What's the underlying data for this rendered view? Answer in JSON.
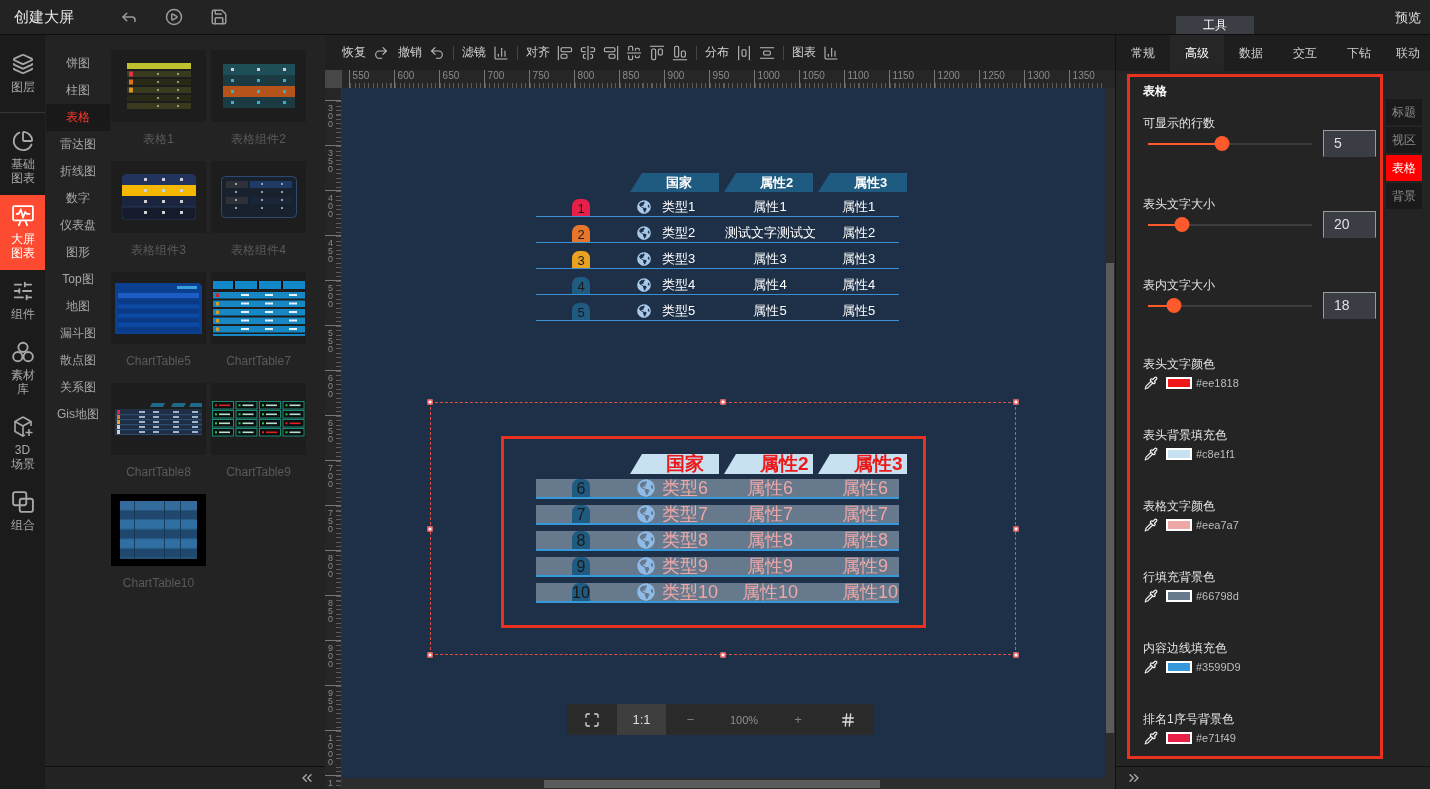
{
  "header": {
    "title": "创建大屏",
    "tool_tab": "工具",
    "preview": "预览"
  },
  "rail": [
    {
      "label": "图层",
      "selected": false
    },
    {
      "label": "基础图表",
      "selected": false
    },
    {
      "label": "大屏图表",
      "selected": true
    },
    {
      "label": "组件",
      "selected": false
    },
    {
      "label": "素材库",
      "selected": false
    },
    {
      "label": "3D场景",
      "selected": false
    },
    {
      "label": "组合",
      "selected": false
    }
  ],
  "categories": [
    {
      "label": "饼图",
      "selected": false
    },
    {
      "label": "柱图",
      "selected": false
    },
    {
      "label": "表格",
      "selected": true
    },
    {
      "label": "雷达图",
      "selected": false
    },
    {
      "label": "折线图",
      "selected": false
    },
    {
      "label": "数字",
      "selected": false
    },
    {
      "label": "仪表盘",
      "selected": false
    },
    {
      "label": "图形",
      "selected": false
    },
    {
      "label": "Top图",
      "selected": false
    },
    {
      "label": "地图",
      "selected": false
    },
    {
      "label": "漏斗图",
      "selected": false
    },
    {
      "label": "散点图",
      "selected": false
    },
    {
      "label": "关系图",
      "selected": false
    },
    {
      "label": "Gis地图",
      "selected": false
    }
  ],
  "templates": [
    {
      "label": "表格1"
    },
    {
      "label": "表格组件2"
    },
    {
      "label": "表格组件3"
    },
    {
      "label": "表格组件4"
    },
    {
      "label": "ChartTable5"
    },
    {
      "label": "ChartTable7"
    },
    {
      "label": "ChartTable8"
    },
    {
      "label": "ChartTable9"
    },
    {
      "label": "ChartTable10"
    }
  ],
  "toolbar": {
    "groups": [
      {
        "label": "恢复"
      },
      {
        "label": "撤销"
      },
      {
        "label": "滤镜"
      },
      {
        "label": "对齐"
      },
      {
        "label": "分布"
      },
      {
        "label": "图表"
      }
    ]
  },
  "ruler": {
    "x_labels": [
      "550",
      "600",
      "650",
      "700",
      "750",
      "800",
      "850",
      "900",
      "950",
      "1000",
      "1050",
      "1100",
      "1150",
      "1200",
      "1250",
      "1300",
      "1350"
    ],
    "y_labels": [
      "300",
      "350",
      "400",
      "450",
      "500",
      "550",
      "600",
      "650",
      "700",
      "750",
      "800",
      "850",
      "900",
      "950",
      "1000",
      "1"
    ]
  },
  "canvas": {
    "tables": [
      {
        "kind": "plain",
        "selected": false,
        "highlighted": false,
        "columns": [
          "国家",
          "属性2",
          "属性3"
        ],
        "rows": [
          {
            "rank": "1",
            "color": "#e71f49",
            "country": "类型1",
            "attr_2": "属性1",
            "attr_3": "属性1"
          },
          {
            "rank": "2",
            "color": "#e8762a",
            "country": "类型2",
            "attr_2": "测试文字测试文",
            "attr_3": "属性2"
          },
          {
            "rank": "3",
            "color": "#e9a21f",
            "country": "类型3",
            "attr_2": "属性3",
            "attr_3": "属性3"
          },
          {
            "rank": "4",
            "color": "#1f5a80",
            "country": "类型4",
            "attr_2": "属性4",
            "attr_3": "属性4"
          },
          {
            "rank": "5",
            "color": "#1f5a80",
            "country": "类型5",
            "attr_2": "属性5",
            "attr_3": "属性5"
          }
        ]
      },
      {
        "kind": "custom",
        "selected": true,
        "highlighted": true,
        "columns": [
          "国家",
          "属性2",
          "属性3"
        ],
        "rows": [
          {
            "rank": "6",
            "color": "#1f5a80",
            "country": "类型6",
            "attr_2": "属性6",
            "attr_3": "属性6"
          },
          {
            "rank": "7",
            "color": "#1f5a80",
            "country": "类型7",
            "attr_2": "属性7",
            "attr_3": "属性7"
          },
          {
            "rank": "8",
            "color": "#1f5a80",
            "country": "类型8",
            "attr_2": "属性8",
            "attr_3": "属性8"
          },
          {
            "rank": "9",
            "color": "#1f5a80",
            "country": "类型9",
            "attr_2": "属性9",
            "attr_3": "属性9"
          },
          {
            "rank": "10",
            "color": "#1f5a80",
            "country": "类型10",
            "attr_2": "属性10",
            "attr_3": "属性10"
          }
        ]
      }
    ]
  },
  "zoom_bar": {
    "actual_size": "1:1",
    "actual_size_selected": true,
    "zoom_out": "−",
    "level": "100%",
    "zoom_in": "+"
  },
  "inspector": {
    "highlighted": true,
    "tabs": [
      {
        "label": "常规",
        "selected": false
      },
      {
        "label": "高级",
        "selected": true
      },
      {
        "label": "数据",
        "selected": false
      },
      {
        "label": "交互",
        "selected": false
      },
      {
        "label": "下钻",
        "selected": false
      },
      {
        "label": "联动",
        "selected": false
      }
    ],
    "section_title": "表格",
    "sliders": [
      {
        "label": "可显示的行数",
        "level": 0.45,
        "value": "5"
      },
      {
        "label": "表头文字大小",
        "level": 0.21,
        "value": "20"
      },
      {
        "label": "表内文字大小",
        "level": 0.16,
        "value": "18"
      }
    ],
    "colors": [
      {
        "label": "表头文字颜色",
        "color": "#ee1818",
        "value": "#ee1818"
      },
      {
        "label": "表头背景填充色",
        "color": "#c8e1f1",
        "value": "#c8e1f1"
      },
      {
        "label": "表格文字颜色",
        "color": "#eea7a7",
        "value": "#eea7a7"
      },
      {
        "label": "行填充背景色",
        "color": "#66798d",
        "value": "#66798d"
      },
      {
        "label": "内容边线填充色",
        "color": "#3599d9",
        "value": "#3599D9"
      },
      {
        "label": "排名1序号背景色",
        "color": "#e71f49",
        "value": "#e71f49"
      }
    ],
    "side_nav": [
      {
        "label": "标题",
        "selected": false
      },
      {
        "label": "视区",
        "selected": false
      },
      {
        "label": "表格",
        "selected": true
      },
      {
        "label": "背景",
        "selected": false
      }
    ]
  }
}
